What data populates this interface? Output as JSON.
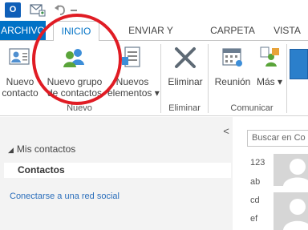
{
  "titlebar": {
    "qat_outlook_icon": "outlook-icon",
    "qat_outlook_glyph": "O",
    "qat_sendrecv_icon": "send-receive-all-icon",
    "qat_undo_icon": "undo-icon"
  },
  "tabs": {
    "file": "ARCHIVO",
    "items": [
      {
        "label": "INICIO",
        "active": true
      },
      {
        "label": "ENVIAR Y RECIBIR",
        "active": false
      },
      {
        "label": "CARPETA",
        "active": false
      },
      {
        "label": "VISTA",
        "active": false
      }
    ]
  },
  "ribbon": {
    "nuevo_contacto": {
      "line1": "Nuevo",
      "line2": "contacto",
      "icon": "contact-card-icon"
    },
    "nuevo_grupo": {
      "line1": "Nuevo grupo",
      "line2": "de contactos",
      "icon": "contact-group-icon"
    },
    "nuevos_elementos": {
      "line1": "Nuevos",
      "line2": "elementos ▾",
      "icon": "new-items-icon"
    },
    "group_nuevo": "Nuevo",
    "eliminar": {
      "label": "Eliminar",
      "icon": "delete-x-icon"
    },
    "group_eliminar": "Eliminar",
    "reunion": {
      "label": "Reunión",
      "icon": "calendar-meeting-icon"
    },
    "mas": {
      "label": "Más",
      "caret": "▾",
      "icon": "more-people-icon"
    },
    "group_comunicar": "Comunicar"
  },
  "nav": {
    "collapse_glyph": "<",
    "section_toggle": "◢",
    "section_title": "Mis contactos",
    "selected_folder": "Contactos",
    "social_link": "Conectarse a una red social"
  },
  "list": {
    "search_placeholder": "Buscar en Co",
    "index_letters": [
      "123",
      "ab",
      "cd",
      "ef"
    ]
  },
  "colors": {
    "accent": "#0072c6",
    "highlight_ring": "#e01c24",
    "link": "#2a6ebb"
  }
}
